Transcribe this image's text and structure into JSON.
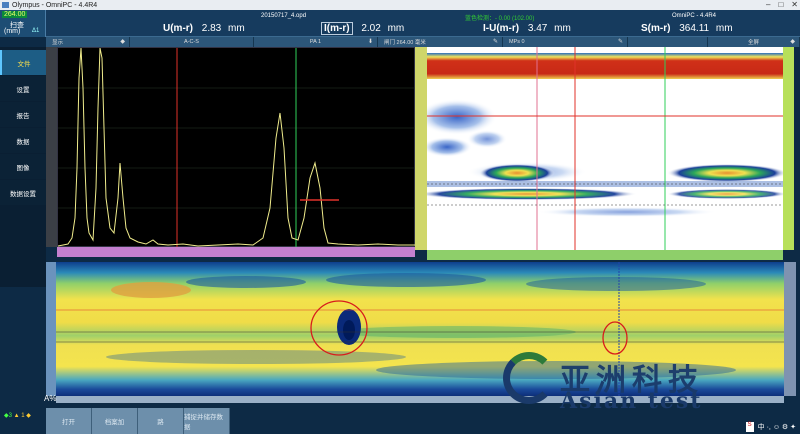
{
  "window": {
    "title": "Olympus - OmniPC - 4.4R4",
    "controls": [
      "–",
      "□",
      "✕"
    ]
  },
  "header": {
    "scan_value": "264.00",
    "scan_label": "扫查",
    "scan_unit": "(mm)",
    "scan_step": "Δ1",
    "filename": "20150717_4.opd",
    "status_green": "蓝色检测：- 0.00 (102.00)",
    "app_name": "OmniPC - 4.4R4",
    "readouts": [
      {
        "label": "U(m-r)",
        "value": "2.83",
        "unit": "mm"
      },
      {
        "label": "I(m-r)",
        "value": "2.02",
        "unit": "mm"
      },
      {
        "label": "I-U(m-r)",
        "value": "3.47",
        "unit": "mm"
      },
      {
        "label": "S(m-r)",
        "value": "364.11",
        "unit": "mm"
      }
    ]
  },
  "subbar": [
    {
      "text": "显示",
      "arrow": "◆"
    },
    {
      "text": "A-C-S",
      "arrow": ""
    },
    {
      "text": "PA 1",
      "arrow": "⬇"
    },
    {
      "text": "闸门  264.00 毫米",
      "arrow": "✎"
    },
    {
      "text": "MPs  0",
      "arrow": "✎"
    },
    {
      "text": "",
      "arrow": ""
    },
    {
      "text": "全屏",
      "arrow": "◆"
    }
  ],
  "sidebar": {
    "items": [
      {
        "label": "文件",
        "active": true
      },
      {
        "label": "设置",
        "active": false
      },
      {
        "label": "报告",
        "active": false
      },
      {
        "label": "数据",
        "active": false
      },
      {
        "label": "图像",
        "active": false
      },
      {
        "label": "数据设置",
        "active": false
      }
    ]
  },
  "bottom": {
    "buttons": [
      "打开",
      "档案加",
      "路",
      "捕捉并储存数据"
    ],
    "status": "◆3 ",
    "status2": "▲ 1 ◆",
    "a_label": "A%"
  },
  "watermark": {
    "chinese": "亚洲科技",
    "english": "Asian test"
  },
  "tray": {
    "badge": "S",
    "icons": "中 ·, ☺ ⚙ ✦"
  },
  "colors": {
    "panel_bg": "#0d2a45",
    "ascan_trace": "#f0ec8c",
    "cursor_red": "#e0322a",
    "cursor_green": "#2fcf5a",
    "cursor_pink": "#e07090"
  }
}
